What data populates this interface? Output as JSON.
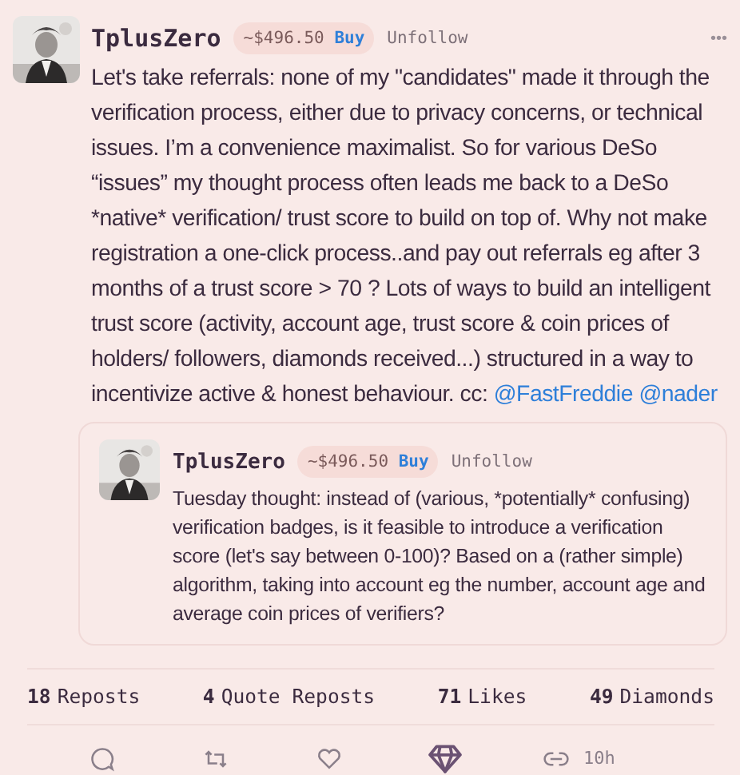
{
  "post": {
    "author": "TplusZero",
    "price": "~$496.50",
    "buy": "Buy",
    "follow": "Unfollow",
    "more": "•••",
    "text": "Let's take referrals: none of my \"candidates\" made it through the verification process, either due to privacy concerns, or technical issues. I’m a convenience maximalist. So for various DeSo “issues” my thought process often leads me back to a DeSo *native* verification/ trust score to build on top of. Why not make registration a one-click process..and pay out referrals eg after 3 months of a trust score > 70 ? Lots of ways to build an intelligent trust score (activity, account age, trust score & coin prices of holders/ followers, diamonds received...) structured in a way to incentivize active & honest behaviour. cc:",
    "mentions": [
      "@FastFreddie",
      "@nader"
    ]
  },
  "quoted": {
    "author": "TplusZero",
    "price": "~$496.50",
    "buy": "Buy",
    "follow": "Unfollow",
    "text": "Tuesday thought: instead of (various, *potentially* confusing) verification badges, is it feasible to introduce a verification score (let's say between 0-100)? Based on a (rather simple) algorithm, taking into account eg the number, account age and average coin prices of verifiers?"
  },
  "stats": [
    {
      "count": "18",
      "label": "Reposts"
    },
    {
      "count": "4",
      "label": "Quote Reposts"
    },
    {
      "count": "71",
      "label": "Likes"
    },
    {
      "count": "49",
      "label": "Diamonds"
    }
  ],
  "actions": [
    {
      "kind": "comment"
    },
    {
      "kind": "repost"
    },
    {
      "kind": "like"
    },
    {
      "kind": "diamond"
    },
    {
      "kind": "link"
    }
  ],
  "time": "10h"
}
